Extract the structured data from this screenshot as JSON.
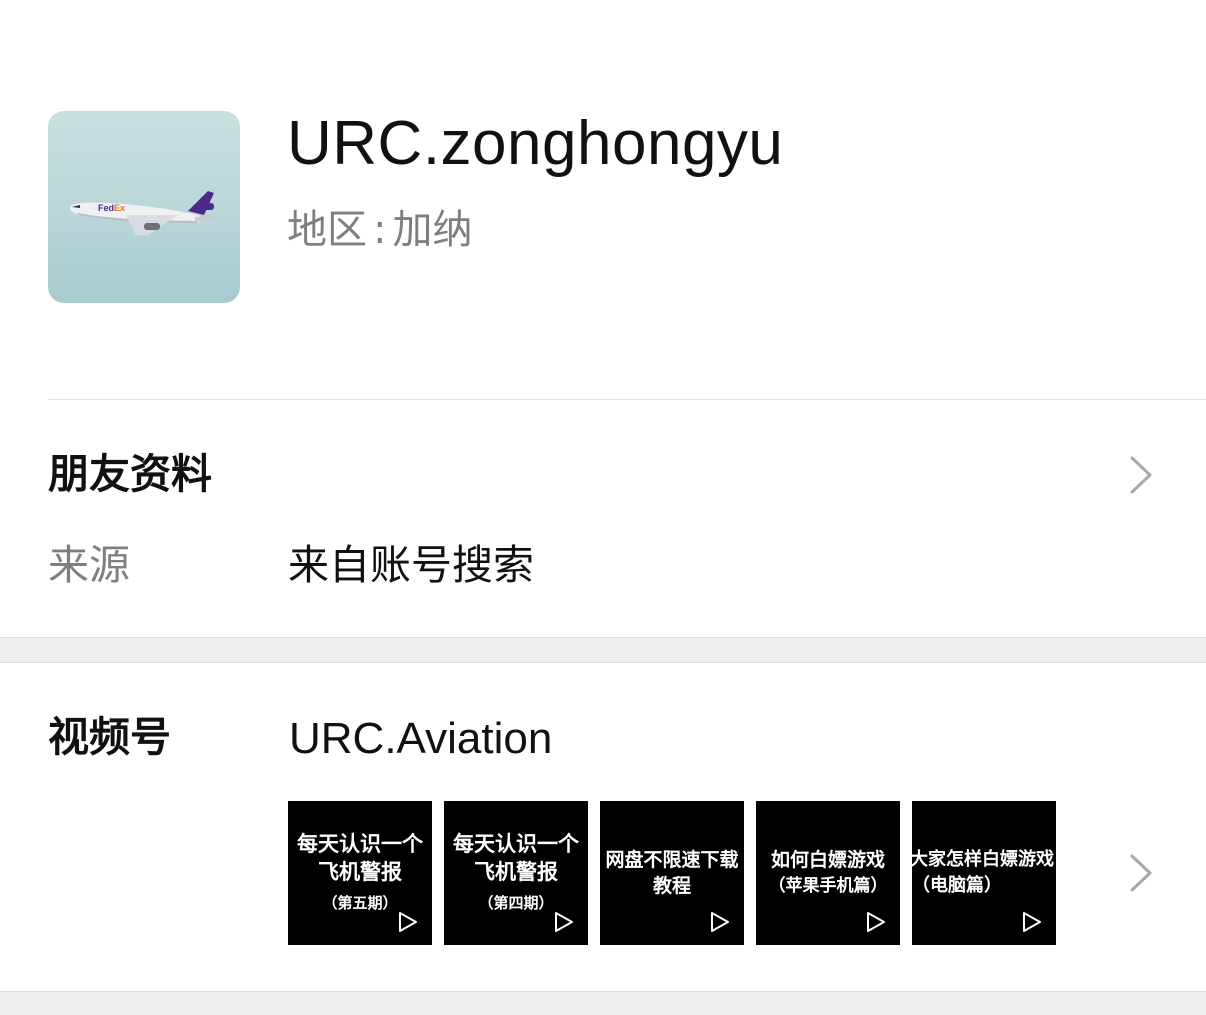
{
  "profile": {
    "nickname": "URC.zonghongyu",
    "region_label": "地区",
    "region_colon": ":",
    "region_value": "加纳",
    "avatar_icon": "airplane-photo-icon"
  },
  "friend_info": {
    "title": "朋友资料",
    "source_label": "来源",
    "source_value": "来自账号搜索"
  },
  "channels": {
    "title": "视频号",
    "name": "URC.Aviation",
    "thumbnails": [
      {
        "line1": "每天认识一个",
        "line2": "飞机警报",
        "line3": "（第五期）"
      },
      {
        "line1": "每天认识一个",
        "line2": "飞机警报",
        "line3": "（第四期）"
      },
      {
        "line1": "网盘不限速下载",
        "line2": "教程",
        "line3": ""
      },
      {
        "line1": "如何白嫖游戏",
        "line2": "（苹果手机篇）",
        "line3": ""
      },
      {
        "line1": "大家怎样白嫖游戏",
        "line2": "（电脑篇）",
        "line3": ""
      }
    ]
  },
  "colors": {
    "background": "#ffffff",
    "separator": "#ededed",
    "secondary_text": "#7f7f7f",
    "primary_text": "#111111"
  }
}
